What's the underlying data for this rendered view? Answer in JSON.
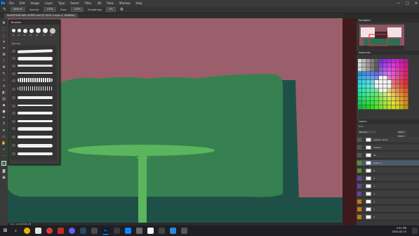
{
  "app": {
    "logo": "Ps",
    "menu": [
      "File",
      "Edit",
      "Image",
      "Layer",
      "Type",
      "Select",
      "Filter",
      "3D",
      "View",
      "Window",
      "Help"
    ],
    "window_controls": [
      "—",
      "□",
      "✕"
    ]
  },
  "options": {
    "mode": "Normal",
    "opacity_label": "Opacity:",
    "opacity": "100%",
    "flow_label": "Flow:",
    "flow": "100%",
    "smoothing_label": "Smoothing:",
    "smoothing": "0%"
  },
  "document": {
    "tab_title": "SAGATORN BAR ASMFE.psd @ 100% (Layer 4, RGB/8#)",
    "status": "Doc: 19.9M/586.4M"
  },
  "brushes_panel": {
    "title": "Brushes",
    "tip_sizes": [
      "30",
      "30",
      "30",
      "25",
      "25",
      "36",
      "25",
      "26"
    ],
    "group_label": "General"
  },
  "navigator": {
    "title": "Navigator"
  },
  "swatches": {
    "title": "Swatches"
  },
  "layers": {
    "title": "Layers",
    "filter_label": "Kind",
    "blend": "Normal",
    "opacity": "100%",
    "fill": "100%",
    "items": [
      {
        "name": "sparkle vector",
        "group": "gray"
      },
      {
        "name": "shadow",
        "group": "gray"
      },
      {
        "name": "fill",
        "group": "gray"
      },
      {
        "name": "Layer 4",
        "group": "green"
      },
      {
        "name": "6",
        "group": "green"
      },
      {
        "name": "5",
        "group": "purple"
      },
      {
        "name": "4",
        "group": "purple"
      },
      {
        "name": "3",
        "group": "purple"
      },
      {
        "name": "2",
        "group": "orange"
      },
      {
        "name": "1",
        "group": "orange"
      },
      {
        "name": "0",
        "group": "orange"
      }
    ]
  },
  "taskbar": {
    "time": "2:51 PM",
    "date": "2020-02-10"
  },
  "colors": {
    "canvas_bg": "#9a5f6a",
    "couch_green": "#37804f",
    "couch_shadow": "#1f5048",
    "table_green": "#5bb55d",
    "dark_strip": "#3f1a1c",
    "group_green": "#5a8f2a",
    "group_purple": "#6b3fa0",
    "group_orange": "#c9780a"
  }
}
